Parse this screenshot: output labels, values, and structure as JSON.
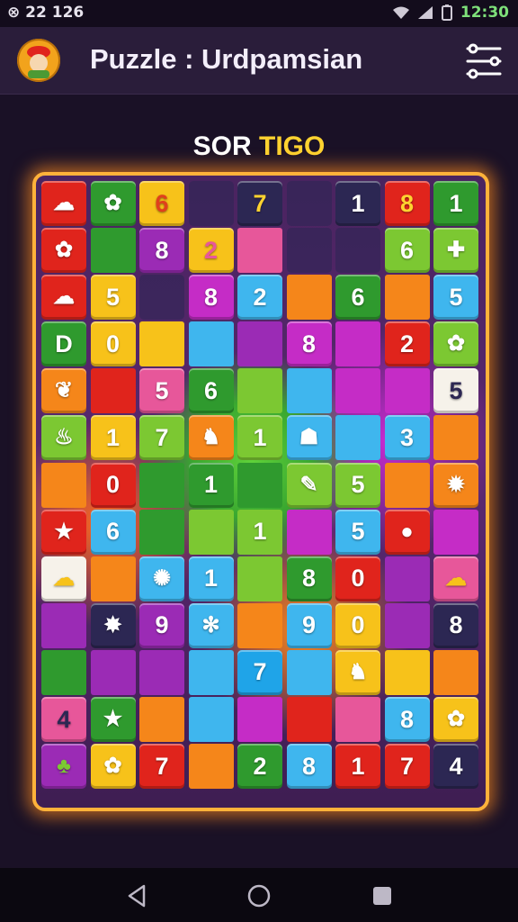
{
  "status": {
    "left_text": "⊗ 22 126",
    "clock": "12:30"
  },
  "header": {
    "title": "Puzzle : Urdpamsian"
  },
  "subtitle": {
    "part1": "SOR ",
    "part2": "TIGO"
  },
  "colors": {
    "red": "#e0241c",
    "green": "#2f9a2e",
    "lime": "#7cc832",
    "yellow": "#f7c21a",
    "orange": "#f5861a",
    "purple": "#9b2bb5",
    "magenta": "#c52cc6",
    "blue": "#1fa4e8",
    "sky": "#3fb6ee",
    "pink": "#e7579a",
    "navy": "#2c2753",
    "frame": "#ffb23a"
  },
  "board": {
    "rows": [
      [
        {
          "t": "cloud-icon",
          "c": "red"
        },
        {
          "t": "flower-icon",
          "c": "green"
        },
        {
          "t": "6",
          "c": "yellow",
          "fg": "#e0401c"
        },
        {
          "t": "",
          "c": "navy",
          "e": 1
        },
        {
          "t": "7",
          "c": "navy",
          "fg": "#ffd330"
        },
        {
          "t": "",
          "c": "navy",
          "e": 1
        },
        {
          "t": "1",
          "c": "navy"
        },
        {
          "t": "8",
          "c": "red",
          "fg": "#ffd330"
        },
        {
          "t": "1",
          "c": "green"
        }
      ],
      [
        {
          "t": "flower-icon",
          "c": "red"
        },
        {
          "t": "",
          "c": "green",
          "p": 1
        },
        {
          "t": "8",
          "c": "purple"
        },
        {
          "t": "2",
          "c": "yellow",
          "fg": "#e7579a"
        },
        {
          "t": "",
          "c": "pink",
          "p": 1
        },
        {
          "t": "",
          "c": "navy",
          "e": 1
        },
        {
          "t": "",
          "c": "navy",
          "e": 1
        },
        {
          "t": "6",
          "c": "lime"
        },
        {
          "t": "cross-icon",
          "c": "lime"
        }
      ],
      [
        {
          "t": "cloud-icon",
          "c": "red"
        },
        {
          "t": "5",
          "c": "yellow"
        },
        {
          "t": "",
          "c": "navy",
          "e": 1
        },
        {
          "t": "8",
          "c": "magenta"
        },
        {
          "t": "2",
          "c": "sky"
        },
        {
          "t": "",
          "c": "orange",
          "p": 1
        },
        {
          "t": "6",
          "c": "green"
        },
        {
          "t": "",
          "c": "orange",
          "p": 1
        },
        {
          "t": "5",
          "c": "sky"
        }
      ],
      [
        {
          "t": "D",
          "c": "green"
        },
        {
          "t": "0",
          "c": "yellow"
        },
        {
          "t": "",
          "c": "yellow",
          "p": 1
        },
        {
          "t": "",
          "c": "sky",
          "p": 1
        },
        {
          "t": "",
          "c": "purple",
          "p": 1
        },
        {
          "t": "8",
          "c": "magenta"
        },
        {
          "t": "",
          "c": "magenta",
          "p": 1
        },
        {
          "t": "2",
          "c": "red"
        },
        {
          "t": "flower-icon",
          "c": "lime"
        }
      ],
      [
        {
          "t": "leaf-icon",
          "c": "orange"
        },
        {
          "t": "",
          "c": "red",
          "p": 1
        },
        {
          "t": "5",
          "c": "pink"
        },
        {
          "t": "6",
          "c": "green"
        },
        {
          "t": "",
          "c": "lime",
          "p": 1
        },
        {
          "t": "",
          "c": "sky",
          "p": 1
        },
        {
          "t": "",
          "c": "magenta",
          "p": 1
        },
        {
          "t": "",
          "c": "magenta",
          "p": 1
        },
        {
          "t": "5",
          "c": "white",
          "fg": "#2c2753"
        }
      ],
      [
        {
          "t": "potion-icon",
          "c": "lime"
        },
        {
          "t": "1",
          "c": "yellow"
        },
        {
          "t": "7",
          "c": "lime"
        },
        {
          "t": "dog-icon",
          "c": "orange"
        },
        {
          "t": "1",
          "c": "lime"
        },
        {
          "t": "slime-icon",
          "c": "sky"
        },
        {
          "t": "",
          "c": "sky",
          "p": 1
        },
        {
          "t": "3",
          "c": "sky"
        },
        {
          "t": "",
          "c": "orange",
          "p": 1
        }
      ],
      [
        {
          "t": "",
          "c": "orange",
          "p": 1
        },
        {
          "t": "0",
          "c": "red"
        },
        {
          "t": "",
          "c": "green",
          "p": 1
        },
        {
          "t": "1",
          "c": "green"
        },
        {
          "t": "",
          "c": "green",
          "p": 1
        },
        {
          "t": "paw-icon",
          "c": "lime"
        },
        {
          "t": "5",
          "c": "lime"
        },
        {
          "t": "",
          "c": "orange",
          "p": 1
        },
        {
          "t": "splat-icon",
          "c": "orange"
        }
      ],
      [
        {
          "t": "star-icon",
          "c": "red"
        },
        {
          "t": "6",
          "c": "sky"
        },
        {
          "t": "",
          "c": "green",
          "p": 1
        },
        {
          "t": "",
          "c": "lime",
          "p": 1
        },
        {
          "t": "1",
          "c": "lime",
          "p": 1
        },
        {
          "t": "",
          "c": "magenta",
          "p": 1
        },
        {
          "t": "5",
          "c": "sky"
        },
        {
          "t": "blob-icon",
          "c": "red"
        },
        {
          "t": "",
          "c": "magenta",
          "p": 1
        }
      ],
      [
        {
          "t": "cloud-icon",
          "c": "white",
          "fg": "#f7c21a"
        },
        {
          "t": "",
          "c": "orange",
          "p": 1
        },
        {
          "t": "bug-icon",
          "c": "sky"
        },
        {
          "t": "1",
          "c": "sky"
        },
        {
          "t": "",
          "c": "lime",
          "p": 1
        },
        {
          "t": "8",
          "c": "green"
        },
        {
          "t": "0",
          "c": "red"
        },
        {
          "t": "",
          "c": "purple",
          "p": 1
        },
        {
          "t": "cloud-icon",
          "c": "pink",
          "fg": "#f7c21a"
        }
      ],
      [
        {
          "t": "",
          "c": "purple",
          "p": 1
        },
        {
          "t": "burst-icon",
          "c": "navy"
        },
        {
          "t": "9",
          "c": "purple"
        },
        {
          "t": "gear-icon",
          "c": "sky"
        },
        {
          "t": "",
          "c": "orange",
          "p": 1
        },
        {
          "t": "9",
          "c": "sky"
        },
        {
          "t": "0",
          "c": "yellow"
        },
        {
          "t": "",
          "c": "purple",
          "p": 1
        },
        {
          "t": "8",
          "c": "navy"
        }
      ],
      [
        {
          "t": "",
          "c": "green",
          "p": 1
        },
        {
          "t": "",
          "c": "purple",
          "p": 1
        },
        {
          "t": "",
          "c": "purple",
          "p": 1
        },
        {
          "t": "",
          "c": "sky",
          "p": 1
        },
        {
          "t": "7",
          "c": "blue"
        },
        {
          "t": "",
          "c": "sky",
          "p": 1
        },
        {
          "t": "dog-icon",
          "c": "yellow"
        },
        {
          "t": "",
          "c": "yellow",
          "p": 1
        },
        {
          "t": "",
          "c": "orange",
          "p": 1
        }
      ],
      [
        {
          "t": "4",
          "c": "pink",
          "fg": "#2c2753"
        },
        {
          "t": "star-icon",
          "c": "green"
        },
        {
          "t": "",
          "c": "orange",
          "p": 1
        },
        {
          "t": "",
          "c": "sky",
          "p": 1
        },
        {
          "t": "",
          "c": "magenta",
          "p": 1
        },
        {
          "t": "",
          "c": "red",
          "p": 1
        },
        {
          "t": "",
          "c": "pink",
          "p": 1
        },
        {
          "t": "8",
          "c": "sky"
        },
        {
          "t": "flower-icon",
          "c": "yellow"
        }
      ],
      [
        {
          "t": "clover-icon",
          "c": "purple",
          "fg": "#7cc832"
        },
        {
          "t": "flower-icon",
          "c": "yellow"
        },
        {
          "t": "7",
          "c": "red"
        },
        {
          "t": "",
          "c": "orange",
          "p": 1
        },
        {
          "t": "2",
          "c": "green"
        },
        {
          "t": "8",
          "c": "sky"
        },
        {
          "t": "1",
          "c": "red"
        },
        {
          "t": "7",
          "c": "red"
        },
        {
          "t": "4",
          "c": "navy",
          "fg": "#ffffff"
        }
      ]
    ]
  }
}
